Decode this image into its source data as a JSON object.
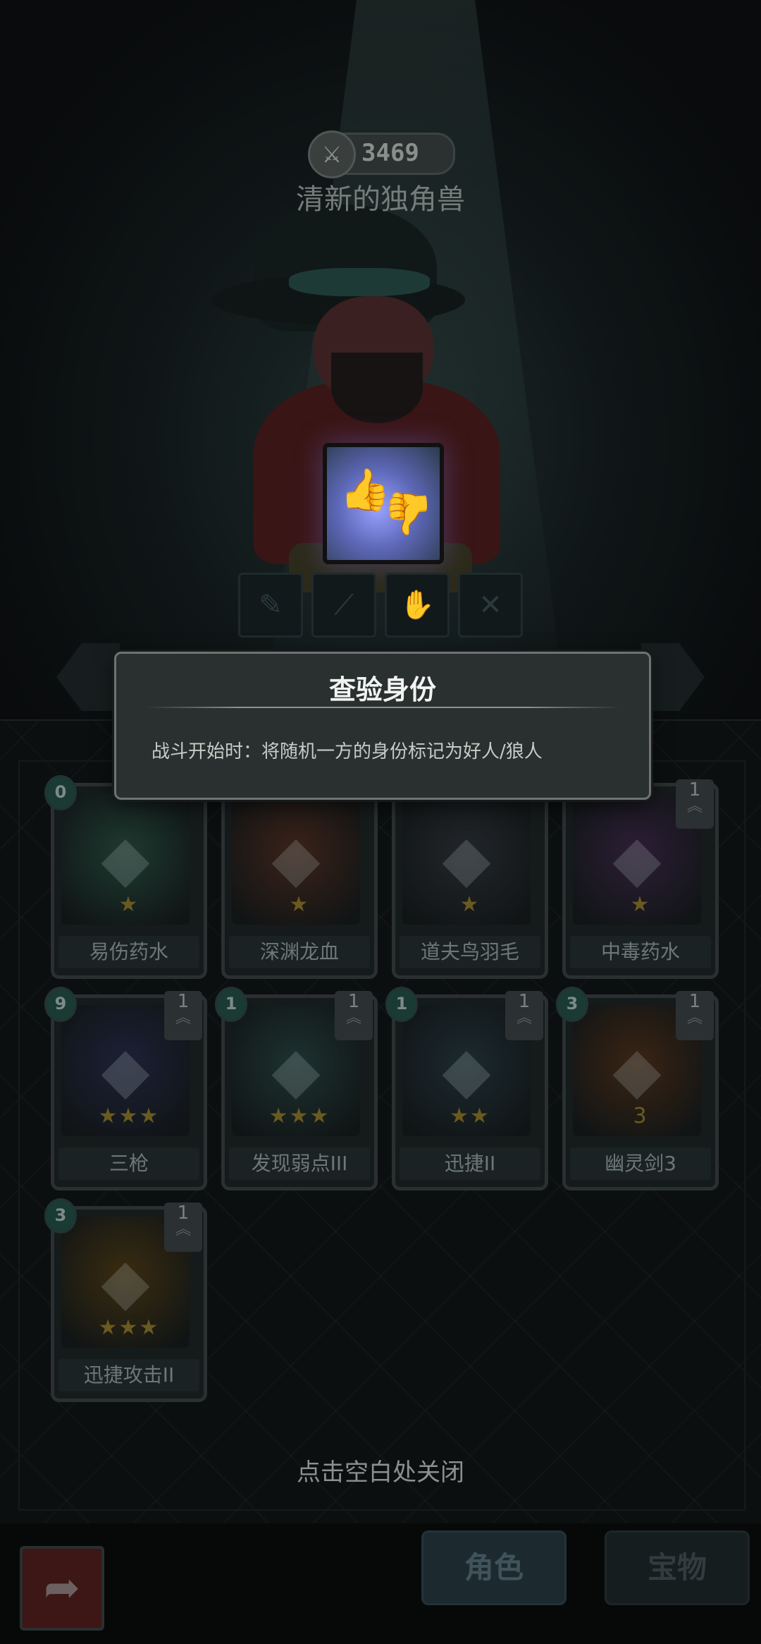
{
  "hero": {
    "power_icon": "sword-icon",
    "power": "3469",
    "name": "清新的独角兽"
  },
  "skill_slots": [
    "scout-icon",
    "wand-icon",
    "thumbs-icon",
    "crossed-swords-icon"
  ],
  "tooltip": {
    "title": "查验身份",
    "description": "战斗开始时：将随机一方的身份标记为好人/狼人"
  },
  "cards": [
    {
      "name": "易伤药水",
      "cost": "0",
      "level": "",
      "stars": "★",
      "color": "#1e3a30"
    },
    {
      "name": "深渊龙血",
      "cost": "",
      "level": "",
      "stars": "★",
      "color": "#3a2218"
    },
    {
      "name": "道夫鸟羽毛",
      "cost": "",
      "level": "",
      "stars": "★",
      "color": "#22262a"
    },
    {
      "name": "中毒药水",
      "cost": "",
      "level": "1",
      "stars": "★",
      "color": "#2c1e36"
    },
    {
      "name": "三枪",
      "cost": "9",
      "level": "1",
      "stars": "★★★",
      "color": "#1c2036"
    },
    {
      "name": "发现弱点III",
      "cost": "1",
      "level": "1",
      "stars": "★★★",
      "color": "#1d3230"
    },
    {
      "name": "迅捷II",
      "cost": "1",
      "level": "1",
      "stars": "★★",
      "color": "#1c2a30"
    },
    {
      "name": "幽灵剑3",
      "cost": "3",
      "level": "1",
      "stars": "3",
      "color": "#3a2414"
    },
    {
      "name": "迅捷攻击II",
      "cost": "3",
      "level": "1",
      "stars": "★★★",
      "color": "#3a2c10"
    }
  ],
  "close_hint": "点击空白处关闭",
  "tabs": {
    "character": "角色",
    "treasure": "宝物"
  },
  "back_icon": "back-arrow-icon"
}
